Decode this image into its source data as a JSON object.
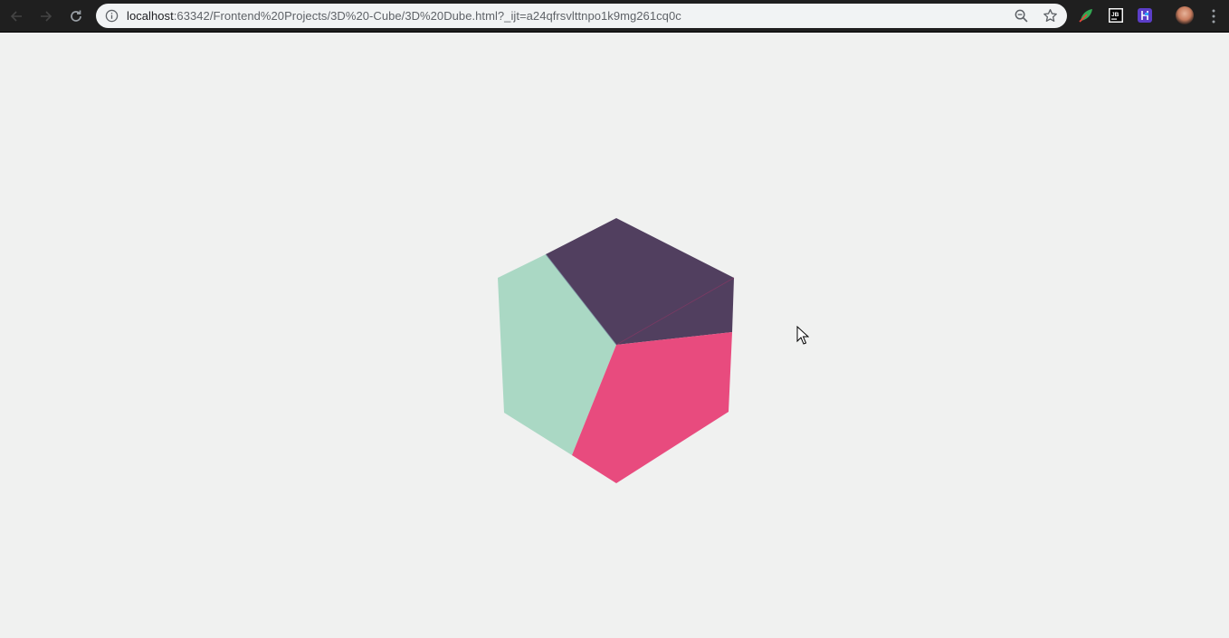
{
  "browser": {
    "url_host": "localhost",
    "url_rest": ":63342/Frontend%20Projects/3D%20-Cube/3D%20Dube.html?_ijt=a24qfrsvlttnpo1k9mg261cq0c",
    "icons": {
      "back": "back-arrow-icon",
      "forward": "forward-arrow-icon",
      "reload": "reload-icon",
      "site_info": "info-icon",
      "zoom": "zoom-icon",
      "bookmark": "star-icon",
      "extension_1": "leaf-extension-icon",
      "extension_2": "jetbrains-extension-icon",
      "extension_3": "extension-icon",
      "profile": "avatar",
      "menu": "more-vert-icon"
    }
  },
  "cube": {
    "faces": [
      {
        "name": "top-face",
        "color": "#513f5f"
      },
      {
        "name": "left-face",
        "color": "#aad8c4"
      },
      {
        "name": "right-face",
        "color": "#e84b7e"
      }
    ]
  }
}
